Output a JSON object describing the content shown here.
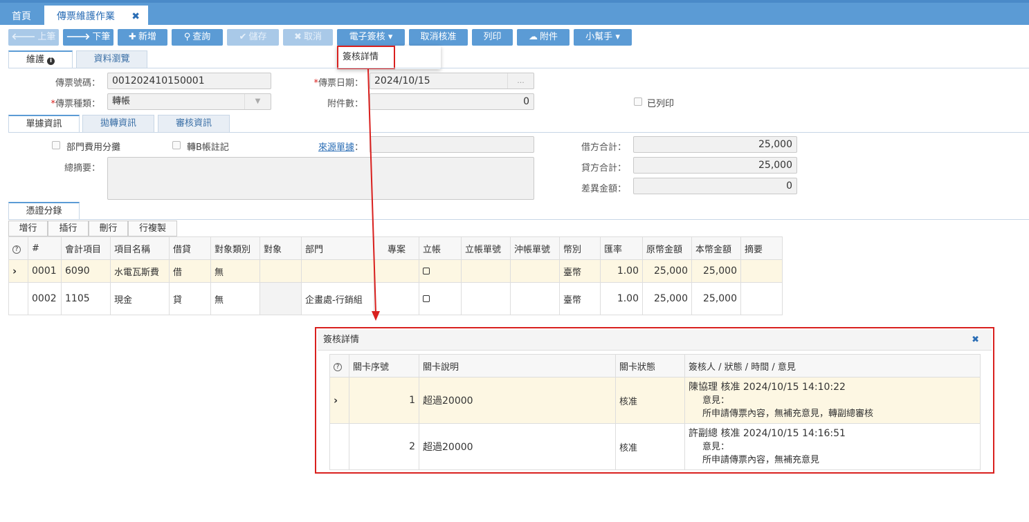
{
  "tabs": {
    "home": "首頁",
    "active": "傳票維護作業"
  },
  "toolbar": {
    "prev": "上筆",
    "next": "下筆",
    "add": "新增",
    "query": "查詢",
    "save": "儲存",
    "cancel": "取消",
    "esign": "電子簽核",
    "uncheck": "取消核准",
    "print": "列印",
    "attach": "附件",
    "helper": "小幫手"
  },
  "dropdown": {
    "item": "簽核詳情"
  },
  "main_tabs": {
    "maintain": "維護",
    "browse": "資料瀏覽"
  },
  "form": {
    "voucher_no_label": "傳票號碼：",
    "voucher_no": "001202410150001",
    "voucher_date_label": "傳票日期：",
    "voucher_date": "2024/10/15",
    "date_btn": "...",
    "voucher_type_label": "傳票種類：",
    "voucher_type": "轉帳",
    "attach_count_label": "附件數：",
    "attach_count": "0",
    "printed_label": "已列印"
  },
  "doc_tabs": {
    "doc_info": "單據資訊",
    "transfer_info": "拋轉資訊",
    "audit_info": "審核資訊"
  },
  "doc": {
    "dept_alloc": "部門費用分攤",
    "b_account": "轉B帳註記",
    "source_label": "來源單據",
    "colon": "：",
    "summary_label": "總摘要：",
    "debit_total_label": "借方合計：",
    "debit_total": "25,000",
    "credit_total_label": "貸方合計：",
    "credit_total": "25,000",
    "diff_label": "差異金額：",
    "diff": "0"
  },
  "entries_tab": "憑證分錄",
  "grid_buttons": {
    "add_row": "增行",
    "insert_row": "插行",
    "delete_row": "刪行",
    "copy_row": "行複製"
  },
  "grid": {
    "headers": [
      "#",
      "會計項目",
      "項目名稱",
      "借貸",
      "對象類別",
      "對象",
      "部門",
      "專案",
      "立帳",
      "立帳單號",
      "沖帳單號",
      "幣別",
      "匯率",
      "原幣金額",
      "本幣金額",
      "摘要"
    ],
    "rows": [
      {
        "no": "0001",
        "account": "6090",
        "name": "水電瓦斯費",
        "dc": "借",
        "obj_type": "無",
        "obj": "",
        "dept": "",
        "project": "",
        "open_no": "",
        "settle_no": "",
        "currency": "臺幣",
        "rate": "1.00",
        "orig_amt": "25,000",
        "local_amt": "25,000",
        "memo": ""
      },
      {
        "no": "0002",
        "account": "1105",
        "name": "現金",
        "dc": "貸",
        "obj_type": "無",
        "obj": "",
        "dept": "企畫處-行銷組",
        "project": "",
        "open_no": "",
        "settle_no": "",
        "currency": "臺幣",
        "rate": "1.00",
        "orig_amt": "25,000",
        "local_amt": "25,000",
        "memo": ""
      }
    ]
  },
  "popup": {
    "title": "簽核詳情",
    "headers": [
      "關卡序號",
      "關卡說明",
      "關卡狀態",
      "簽核人 / 狀態 / 時間 / 意見"
    ],
    "rows": [
      {
        "seq": "1",
        "desc": "超過20000",
        "status": "核准",
        "signer": "陳協理 核准 2024/10/15 14:10:22",
        "opinion_label": "意見：",
        "opinion": "所申請傳票內容，無補充意見，轉副總審核"
      },
      {
        "seq": "2",
        "desc": "超過20000",
        "status": "核准",
        "signer": "許副總 核准 2024/10/15 14:16:51",
        "opinion_label": "意見：",
        "opinion": "所申請傳票內容，無補充意見"
      }
    ]
  },
  "colors": {
    "accent": "#5b9bd5",
    "highlight": "#d9201e",
    "row_selected": "#fdf7e3"
  }
}
